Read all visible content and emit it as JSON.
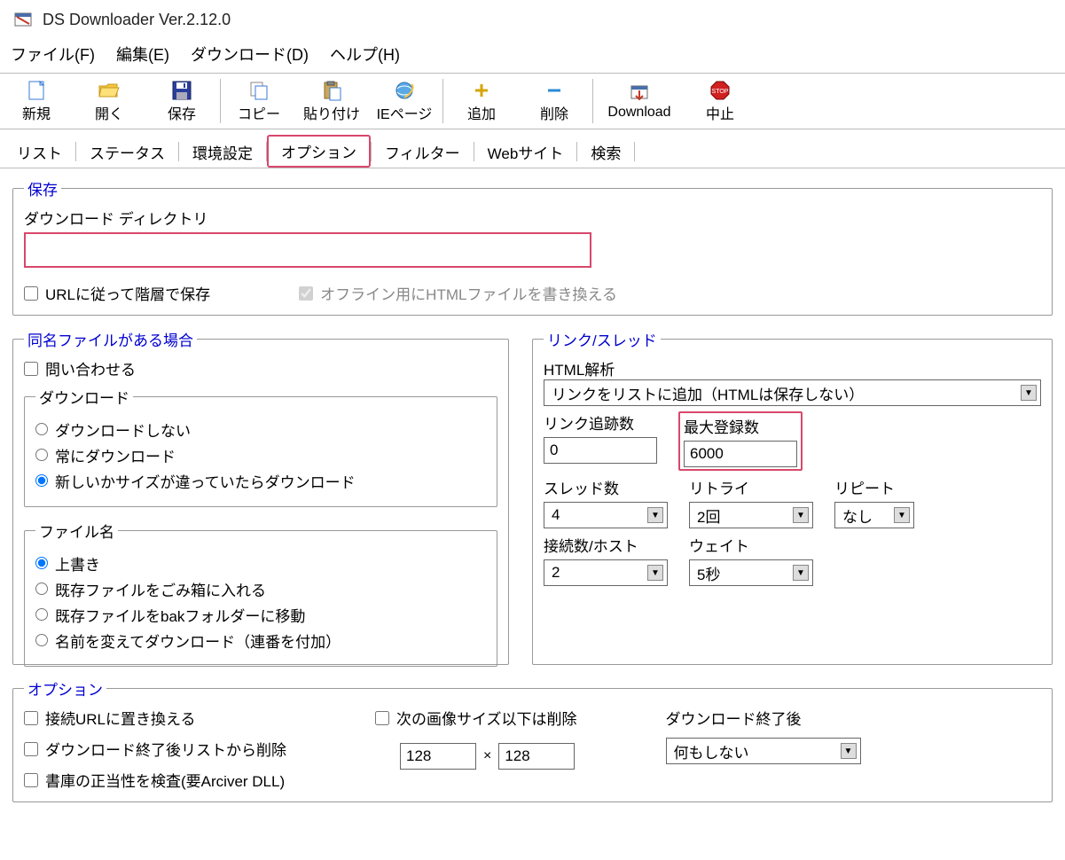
{
  "app": {
    "title": "DS Downloader Ver.2.12.0"
  },
  "menu": {
    "file": "ファイル(F)",
    "edit": "編集(E)",
    "download": "ダウンロード(D)",
    "help": "ヘルプ(H)"
  },
  "toolbar": {
    "new": "新規",
    "open": "開く",
    "save": "保存",
    "copy": "コピー",
    "paste": "貼り付け",
    "iepage": "IEページ",
    "add": "追加",
    "delete": "削除",
    "download": "Download",
    "stop": "中止"
  },
  "tabs": {
    "list": "リスト",
    "status": "ステータス",
    "env": "環境設定",
    "option": "オプション",
    "filter": "フィルター",
    "website": "Webサイト",
    "search": "検索"
  },
  "save_group": {
    "legend": "保存",
    "dir_label": "ダウンロード ディレクトリ",
    "dir_value": "",
    "url_layers": "URLに従って階層で保存",
    "offline_rewrite": "オフライン用にHTMLファイルを書き換える"
  },
  "samefile": {
    "legend": "同名ファイルがある場合",
    "ask": "問い合わせる",
    "download_legend": "ダウンロード",
    "dl_no": "ダウンロードしない",
    "dl_always": "常にダウンロード",
    "dl_newer": "新しいかサイズが違っていたらダウンロード",
    "filename_legend": "ファイル名",
    "overwrite": "上書き",
    "to_trash": "既存ファイルをごみ箱に入れる",
    "to_bak": "既存ファイルをbakフォルダーに移動",
    "rename": "名前を変えてダウンロード（連番を付加）"
  },
  "link": {
    "legend": "リンク/スレッド",
    "html_parse_label": "HTML解析",
    "html_parse_value": "リンクをリストに追加（HTMLは保存しない）",
    "link_follow_label": "リンク追跡数",
    "link_follow_value": "0",
    "max_reg_label": "最大登録数",
    "max_reg_value": "6000",
    "threads_label": "スレッド数",
    "threads_value": "4",
    "retry_label": "リトライ",
    "retry_value": "2回",
    "repeat_label": "リピート",
    "repeat_value": "なし",
    "conn_host_label": "接続数/ホスト",
    "conn_host_value": "2",
    "wait_label": "ウェイト",
    "wait_value": "5秒"
  },
  "options": {
    "legend": "オプション",
    "replace_conn_url": "接続URLに置き換える",
    "remove_after": "ダウンロード終了後リストから削除",
    "check_archive": "書庫の正当性を検査(要Arciver DLL)",
    "min_image_label": "次の画像サイズ以下は削除",
    "img_w": "128",
    "img_x": "×",
    "img_h": "128",
    "after_dl_label": "ダウンロード終了後",
    "after_dl_value": "何もしない"
  }
}
